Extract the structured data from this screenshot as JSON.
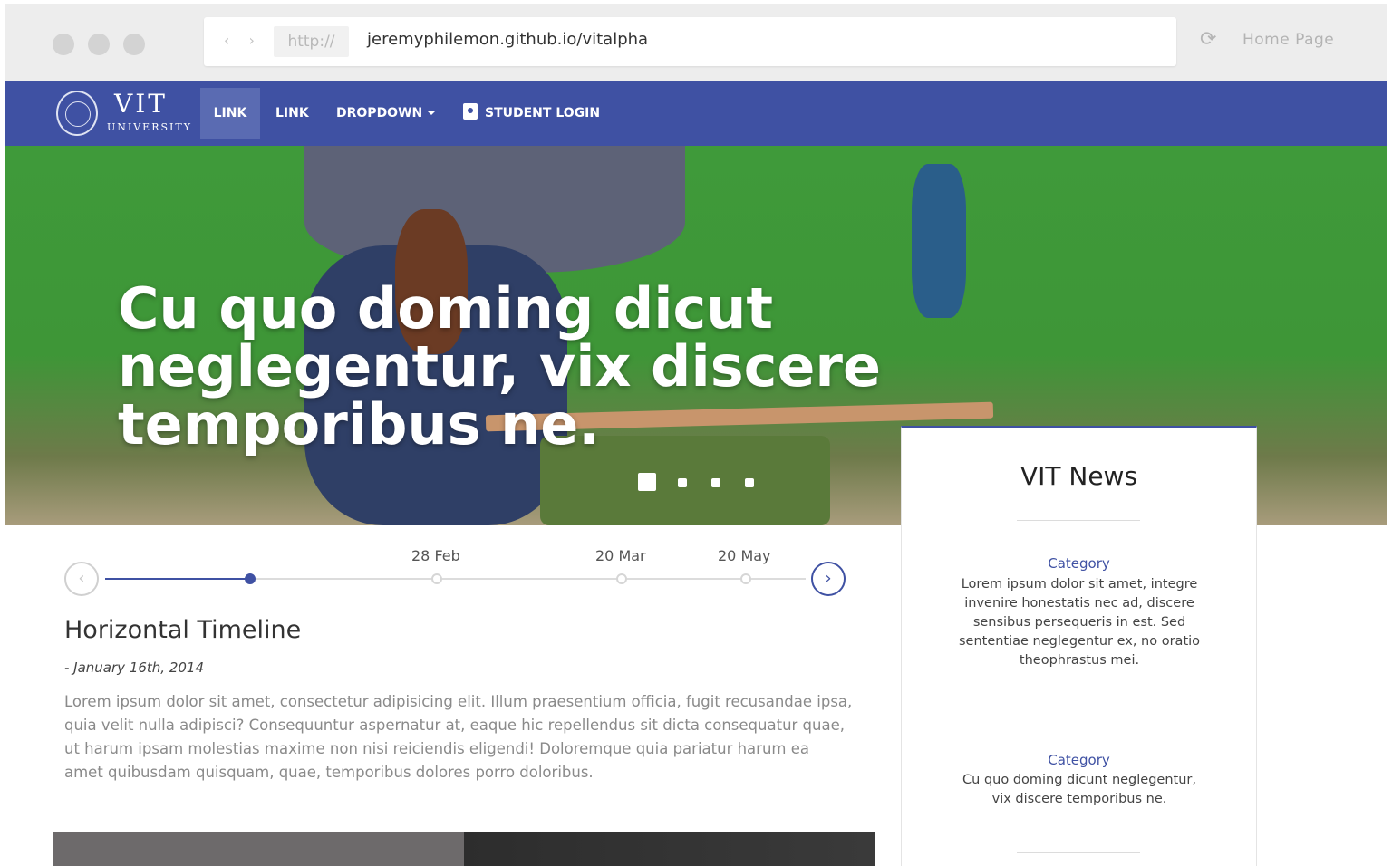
{
  "browser": {
    "protocol": "http://",
    "url": "jeremyphilemon.github.io/vitalpha",
    "home_label": "Home Page"
  },
  "nav": {
    "logo_text": "VIT",
    "logo_subtext": "UNIVERSITY",
    "links": [
      "LINK",
      "LINK",
      "DROPDOWN",
      "STUDENT LOGIN"
    ],
    "accent_color": "#3f51a3"
  },
  "hero": {
    "title": "Cu quo doming dicut neglegentur, vix discere temporibus ne.",
    "slide_count": 4,
    "active_slide": 1
  },
  "timeline": {
    "dates": [
      "28 Feb",
      "20 Mar",
      "20 May"
    ],
    "heading": "Horizontal Timeline",
    "subheading": "- January 16th, 2014",
    "body": "Lorem ipsum dolor sit amet, consectetur adipisicing elit. Illum praesentium officia, fugit recusandae ipsa, quia velit nulla adipisci? Consequuntur aspernatur at, eaque hic repellendus sit dicta consequatur quae, ut harum ipsam molestias maxime non nisi reiciendis eligendi! Doloremque quia pariatur harum ea amet quibusdam quisquam, quae, temporibus dolores porro doloribus.",
    "prev_icon": "chevron-left-icon",
    "next_icon": "chevron-right-icon"
  },
  "news": {
    "title": "VIT News",
    "items": [
      {
        "category": "Category",
        "text": "Lorem ipsum dolor sit amet, integre invenire honestatis nec ad, discere sensibus persequeris in est. Sed sententiae neglegentur ex, no oratio theophrastus mei."
      },
      {
        "category": "Category",
        "text": "Cu quo doming dicunt neglegentur, vix discere temporibus ne."
      }
    ]
  }
}
